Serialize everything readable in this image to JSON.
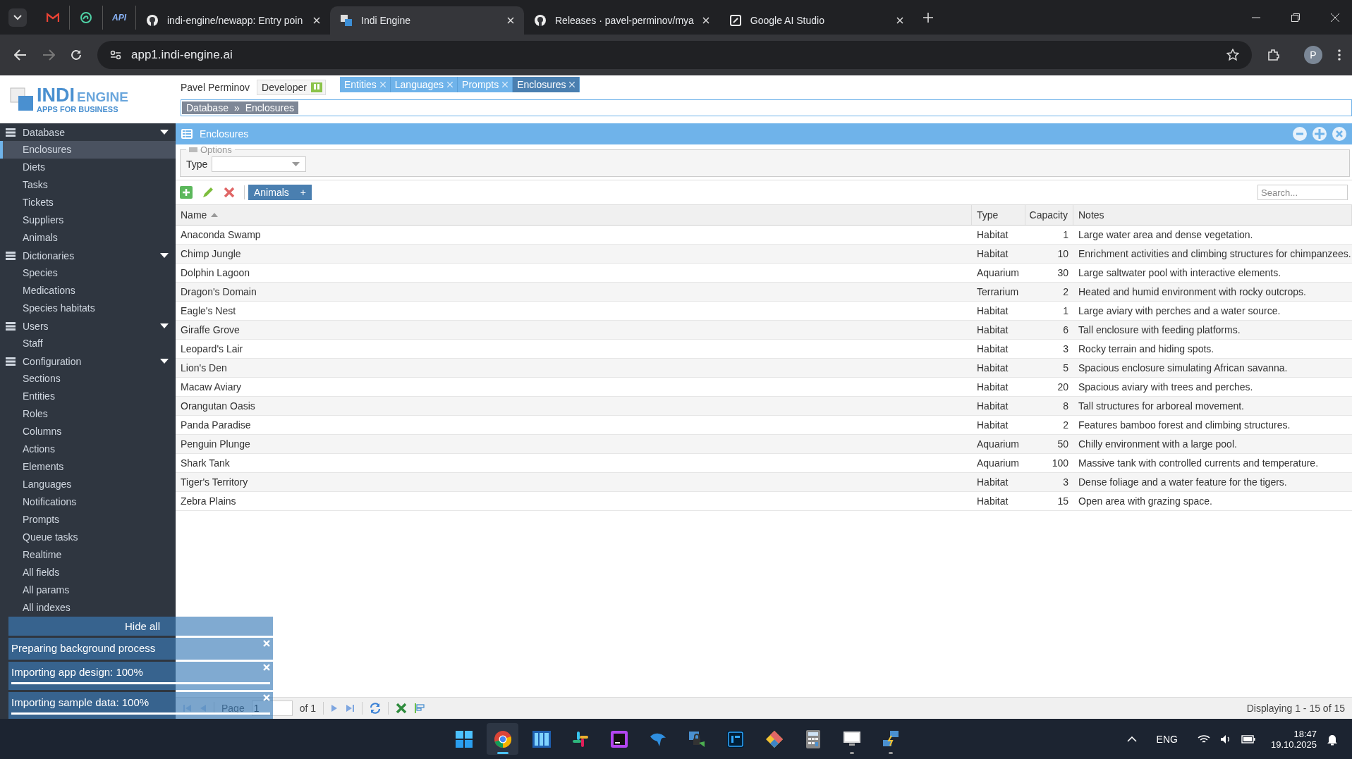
{
  "browser": {
    "pinned_tabs": [
      {
        "kind": "mail"
      },
      {
        "kind": "swirl"
      },
      {
        "kind": "text",
        "label": "API"
      }
    ],
    "tabs": [
      {
        "title": "indi-engine/newapp: Entry poin",
        "kind": "github",
        "selected": false
      },
      {
        "title": "Indi Engine",
        "kind": "squares",
        "selected": true
      },
      {
        "title": "Releases · pavel-perminov/mya",
        "kind": "github",
        "selected": false
      },
      {
        "title": "Google AI Studio",
        "kind": "studio",
        "selected": false
      }
    ],
    "address": "app1.indi-engine.ai",
    "avatar": "P"
  },
  "header": {
    "logo": {
      "main": "INDI",
      "side": "ENGINE",
      "tagline": "APPS FOR BUSINESS"
    },
    "user": "Pavel Perminov",
    "role": "Developer",
    "open_tabs": [
      {
        "label": "Entities",
        "selected": false
      },
      {
        "label": "Languages",
        "selected": false
      },
      {
        "label": "Prompts",
        "selected": false
      },
      {
        "label": "Enclosures",
        "selected": true
      }
    ],
    "breadcrumb": {
      "items": [
        "Database",
        "Enclosures"
      ],
      "separator": "»"
    }
  },
  "sidebar": {
    "sections": [
      {
        "title": "Database",
        "expanded": true,
        "items": [
          {
            "label": "Enclosures",
            "selected": true
          },
          {
            "label": "Diets",
            "selected": false
          },
          {
            "label": "Tasks",
            "selected": false
          },
          {
            "label": "Tickets",
            "selected": false
          },
          {
            "label": "Suppliers",
            "selected": false
          },
          {
            "label": "Animals",
            "selected": false
          }
        ]
      },
      {
        "title": "Dictionaries",
        "expanded": true,
        "items": [
          {
            "label": "Species",
            "selected": false
          },
          {
            "label": "Medications",
            "selected": false
          },
          {
            "label": "Species habitats",
            "selected": false
          }
        ]
      },
      {
        "title": "Users",
        "expanded": true,
        "items": [
          {
            "label": "Staff",
            "selected": false
          }
        ]
      },
      {
        "title": "Configuration",
        "expanded": true,
        "items": [
          {
            "label": "Sections",
            "selected": false
          },
          {
            "label": "Entities",
            "selected": false
          },
          {
            "label": "Roles",
            "selected": false
          },
          {
            "label": "Columns",
            "selected": false
          },
          {
            "label": "Actions",
            "selected": false
          },
          {
            "label": "Elements",
            "selected": false
          },
          {
            "label": "Languages",
            "selected": false
          },
          {
            "label": "Notifications",
            "selected": false
          },
          {
            "label": "Prompts",
            "selected": false
          },
          {
            "label": "Queue tasks",
            "selected": false
          },
          {
            "label": "Realtime",
            "selected": false
          },
          {
            "label": "All fields",
            "selected": false
          },
          {
            "label": "All params",
            "selected": false
          },
          {
            "label": "All indexes",
            "selected": false
          }
        ]
      }
    ]
  },
  "panel": {
    "title": "Enclosures",
    "options": {
      "legend": "Options",
      "filters": [
        {
          "label": "Type"
        }
      ]
    },
    "toolbar": {
      "related_button": "Animals",
      "related_add": "+",
      "search": {
        "placeholder": "Search..."
      }
    },
    "table": {
      "columns": [
        {
          "label": "Name",
          "sorted": true,
          "kind": "text"
        },
        {
          "label": "Type",
          "sorted": false,
          "kind": "text"
        },
        {
          "label": "Capacity",
          "sorted": false,
          "kind": "number"
        },
        {
          "label": "Notes",
          "sorted": false,
          "kind": "text"
        }
      ],
      "rows": [
        [
          "Anaconda Swamp",
          "Habitat",
          "1",
          "Large water area and dense vegetation."
        ],
        [
          "Chimp Jungle",
          "Habitat",
          "10",
          "Enrichment activities and climbing structures for chimpanzees."
        ],
        [
          "Dolphin Lagoon",
          "Aquarium",
          "30",
          "Large saltwater pool with interactive elements."
        ],
        [
          "Dragon's Domain",
          "Terrarium",
          "2",
          "Heated and humid environment with rocky outcrops."
        ],
        [
          "Eagle's Nest",
          "Habitat",
          "1",
          "Large aviary with perches and a water source."
        ],
        [
          "Giraffe Grove",
          "Habitat",
          "6",
          "Tall enclosure with feeding platforms."
        ],
        [
          "Leopard's Lair",
          "Habitat",
          "3",
          "Rocky terrain and hiding spots."
        ],
        [
          "Lion's Den",
          "Habitat",
          "5",
          "Spacious enclosure simulating African savanna."
        ],
        [
          "Macaw Aviary",
          "Habitat",
          "20",
          "Spacious aviary with trees and perches."
        ],
        [
          "Orangutan Oasis",
          "Habitat",
          "8",
          "Tall structures for arboreal movement."
        ],
        [
          "Panda Paradise",
          "Habitat",
          "2",
          "Features bamboo forest and climbing structures."
        ],
        [
          "Penguin Plunge",
          "Aquarium",
          "50",
          "Chilly environment with a large pool."
        ],
        [
          "Shark Tank",
          "Aquarium",
          "100",
          "Massive tank with controlled currents and temperature."
        ],
        [
          "Tiger's Territory",
          "Habitat",
          "3",
          "Dense foliage and a water feature for the tigers."
        ],
        [
          "Zebra Plains",
          "Habitat",
          "15",
          "Open area with grazing space."
        ]
      ]
    },
    "pager": {
      "page_label": "Page",
      "page": "1",
      "of": "of 1",
      "summary": "Displaying 1 - 15 of 15"
    }
  },
  "notifications": {
    "hide_all": "Hide all",
    "items": [
      {
        "text": "Preparing background process",
        "kind": "message"
      },
      {
        "text": "Importing app design: 100%",
        "kind": "progress",
        "level": 1
      },
      {
        "text": "Importing sample data: 100%",
        "kind": "progress",
        "level": 1
      }
    ]
  },
  "taskbar": {
    "apps": [
      {
        "kind": "start",
        "selected": false,
        "running": false
      },
      {
        "kind": "chrome",
        "selected": true,
        "running": true
      },
      {
        "kind": "monitor",
        "selected": false,
        "running": false
      },
      {
        "kind": "slack",
        "selected": false,
        "running": false
      },
      {
        "kind": "phpstorm",
        "selected": false,
        "running": false
      },
      {
        "kind": "dolphin",
        "selected": false,
        "running": false
      },
      {
        "kind": "lock",
        "selected": false,
        "running": false
      },
      {
        "kind": "photoshop",
        "selected": false,
        "running": false
      },
      {
        "kind": "git",
        "selected": false,
        "running": false
      },
      {
        "kind": "calculator",
        "selected": false,
        "running": false
      },
      {
        "kind": "remote",
        "selected": false,
        "running": true
      },
      {
        "kind": "network",
        "selected": false,
        "running": true
      }
    ],
    "language": "ENG",
    "time": "18:47",
    "date": "19.10.2025"
  }
}
